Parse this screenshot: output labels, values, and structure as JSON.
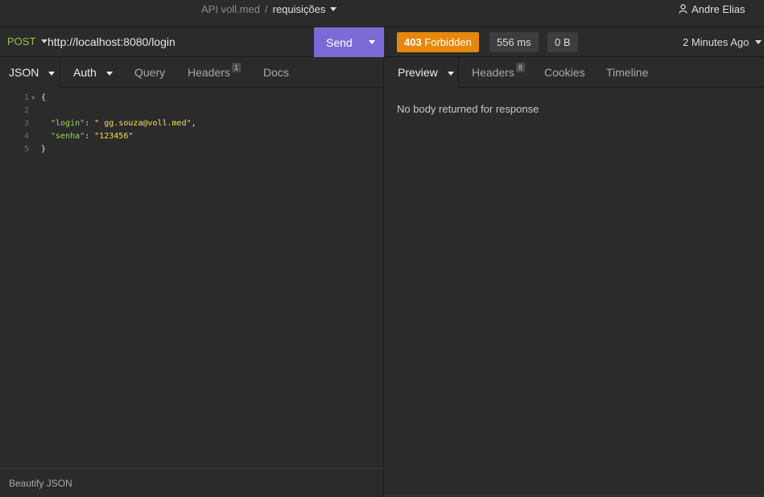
{
  "titlebar": {
    "project": "API voll.med",
    "separator": "/",
    "current": "requisições",
    "user": "Andre Elias"
  },
  "request": {
    "method": "POST",
    "url": "http://localhost:8080/login",
    "send_label": "Send",
    "tabs": [
      {
        "label": "JSON",
        "active": true
      },
      {
        "label": "Auth"
      },
      {
        "label": "Query"
      },
      {
        "label": "Headers",
        "badge": "1"
      },
      {
        "label": "Docs"
      }
    ],
    "body_lines": [
      {
        "n": "1",
        "text": "{"
      },
      {
        "n": "2",
        "text": ""
      },
      {
        "n": "3",
        "key": "\"login\"",
        "value": "\" gg.souza@voll.med\""
      },
      {
        "n": "4",
        "key": "\"senha\"",
        "value": "\"123456\""
      },
      {
        "n": "5",
        "text": "}"
      }
    ],
    "beautify_label": "Beautify JSON"
  },
  "response": {
    "status": "403 Forbidden",
    "status_code": "403",
    "status_text": "Forbidden",
    "time": "556 ms",
    "size": "0 B",
    "ago": "2 Minutes Ago",
    "tabs": [
      {
        "label": "Preview",
        "active": true
      },
      {
        "label": "Headers",
        "badge": "8"
      },
      {
        "label": "Cookies"
      },
      {
        "label": "Timeline"
      }
    ],
    "empty_message": "No body returned for response"
  },
  "colors": {
    "accent": "#7e6ad6",
    "status_error": "#e6870b",
    "method_post": "#8bc34a",
    "json_key": "#9fd356",
    "json_string": "#f0e15a"
  }
}
